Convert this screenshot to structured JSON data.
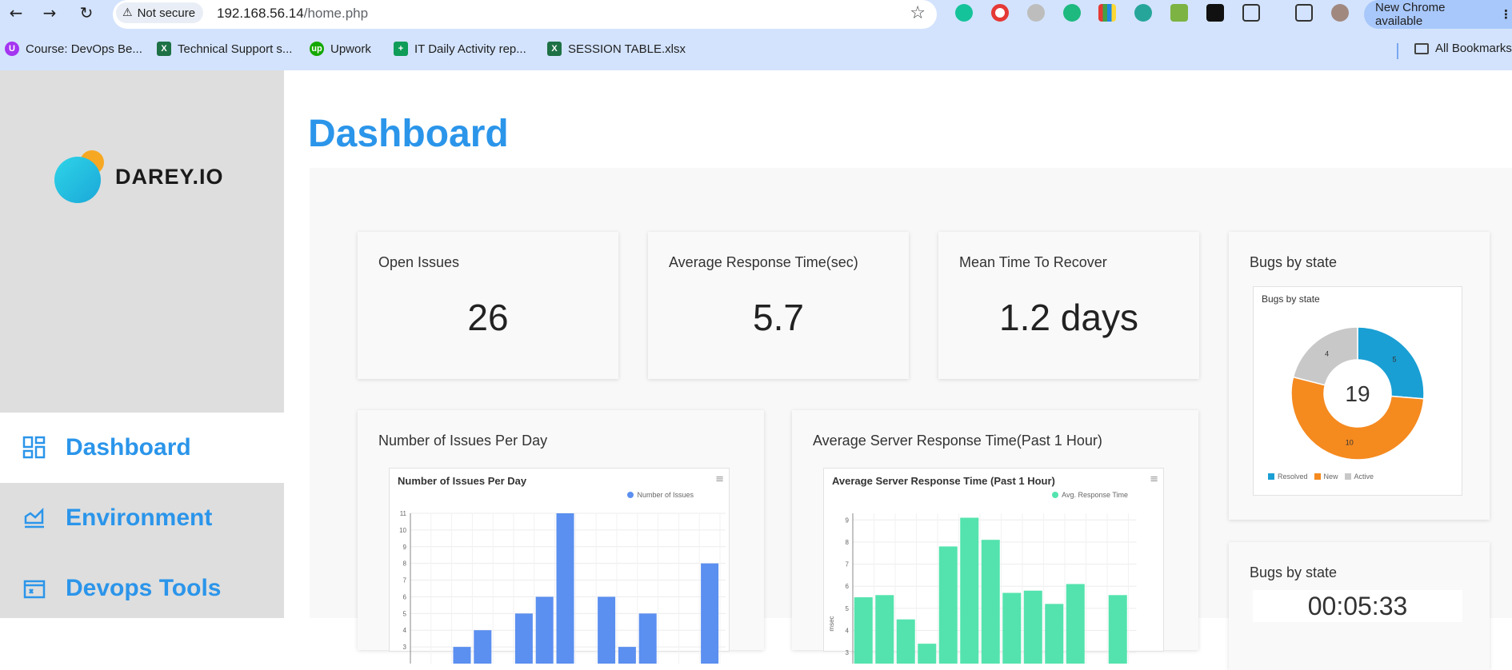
{
  "browser": {
    "not_secure": "Not secure",
    "url_host": "192.168.56.14",
    "url_path": "/home.php",
    "update_label": "New Chrome available",
    "bookmarks": [
      {
        "label": "Course: DevOps Be..."
      },
      {
        "label": "Technical Support s..."
      },
      {
        "label": "Upwork"
      },
      {
        "label": "IT Daily Activity rep..."
      },
      {
        "label": "SESSION TABLE.xlsx"
      }
    ],
    "all_bookmarks": "All Bookmarks"
  },
  "sidebar": {
    "logo_text": "DAREY.IO",
    "items": [
      {
        "label": "Dashboard",
        "icon": "dashboard-icon"
      },
      {
        "label": "Environment",
        "icon": "chart-area-icon"
      },
      {
        "label": "Devops Tools",
        "icon": "tools-icon"
      }
    ]
  },
  "main": {
    "title": "Dashboard",
    "kpis": [
      {
        "title": "Open Issues",
        "value": "26"
      },
      {
        "title": "Average Response Time(sec)",
        "value": "5.7"
      },
      {
        "title": "Mean Time To Recover",
        "value": "1.2 days"
      }
    ],
    "bugs_card": {
      "title": "Bugs by state",
      "chart_title": "Bugs by state",
      "total": "19"
    },
    "issues_card": {
      "title": "Number of Issues Per Day",
      "chart_title": "Number of Issues Per Day",
      "legend": "Number of Issues"
    },
    "response_card": {
      "title": "Average Server Response Time(Past 1 Hour)",
      "chart_title": "Average Server Response Time (Past 1 Hour)",
      "legend": "Avg. Response Time",
      "ylabel": "msec"
    },
    "bugs_card_2": {
      "title": "Bugs by state",
      "timer": "00:05:33"
    }
  },
  "chart_data": [
    {
      "type": "pie",
      "title": "Bugs by state",
      "labels": [
        "Resolved",
        "New",
        "Active"
      ],
      "values": [
        5,
        10,
        4
      ],
      "colors": [
        "#1a9fd4",
        "#f58a1f",
        "#c8c8c8"
      ],
      "center_label": "19",
      "legend": "bottom"
    },
    {
      "type": "bar",
      "title": "Number of Issues Per Day",
      "series": [
        {
          "name": "Number of Issues",
          "values": [
            null,
            null,
            3,
            4,
            null,
            5,
            6,
            11,
            null,
            6,
            3,
            5,
            null,
            null,
            8
          ]
        }
      ],
      "yticks": [
        3,
        4,
        5,
        6,
        7,
        8,
        9,
        10,
        11
      ],
      "ylim": [
        2,
        11
      ],
      "color": "#5b8ff0",
      "legend": "top-right",
      "grid": true
    },
    {
      "type": "bar",
      "title": "Average Server Response Time (Past 1 Hour)",
      "ylabel": "msec",
      "series": [
        {
          "name": "Avg. Response Time",
          "values": [
            5.5,
            5.6,
            4.5,
            3.4,
            7.8,
            9.1,
            8.1,
            5.7,
            5.8,
            5.2,
            6.1,
            null,
            5.6
          ]
        }
      ],
      "yticks": [
        3,
        4,
        5,
        6,
        7,
        8,
        9
      ],
      "ylim": [
        2.5,
        9.3
      ],
      "color": "#54e3ae",
      "legend": "top-right",
      "grid": true
    }
  ]
}
